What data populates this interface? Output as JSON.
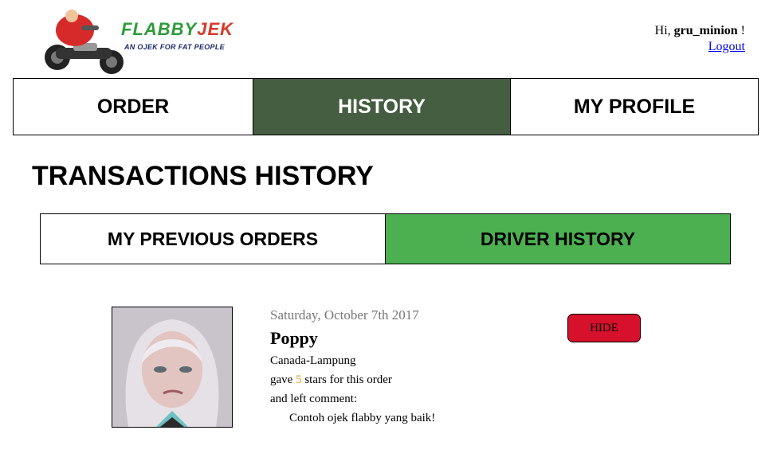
{
  "header": {
    "logo_title_a": "FLABBY",
    "logo_title_b": "JEK",
    "logo_tagline": "AN OJEK FOR FAT PEOPLE",
    "greeting_prefix": "Hi, ",
    "username": "gru_minion",
    "greeting_suffix": " !",
    "logout_label": "Logout"
  },
  "nav": {
    "tabs": [
      {
        "label": "ORDER"
      },
      {
        "label": "HISTORY"
      },
      {
        "label": "MY PROFILE"
      }
    ]
  },
  "page": {
    "title": "TRANSACTIONS HISTORY"
  },
  "subtabs": [
    {
      "label": "MY PREVIOUS ORDERS"
    },
    {
      "label": "DRIVER HISTORY"
    }
  ],
  "entries": [
    {
      "date": "Saturday, October 7th 2017",
      "name": "Poppy",
      "route": "Canada-Lampung",
      "rating_prefix": "gave ",
      "rating": "5",
      "rating_suffix": " stars for this order",
      "comment_label": "and left comment:",
      "comment": "Contoh ojek flabby yang baik!",
      "hide_label": "HIDE"
    }
  ],
  "colors": {
    "nav_active": "#455d40",
    "subtab_active": "#4caf50",
    "hide_button": "#d7102c",
    "star": "#e5a02a"
  }
}
